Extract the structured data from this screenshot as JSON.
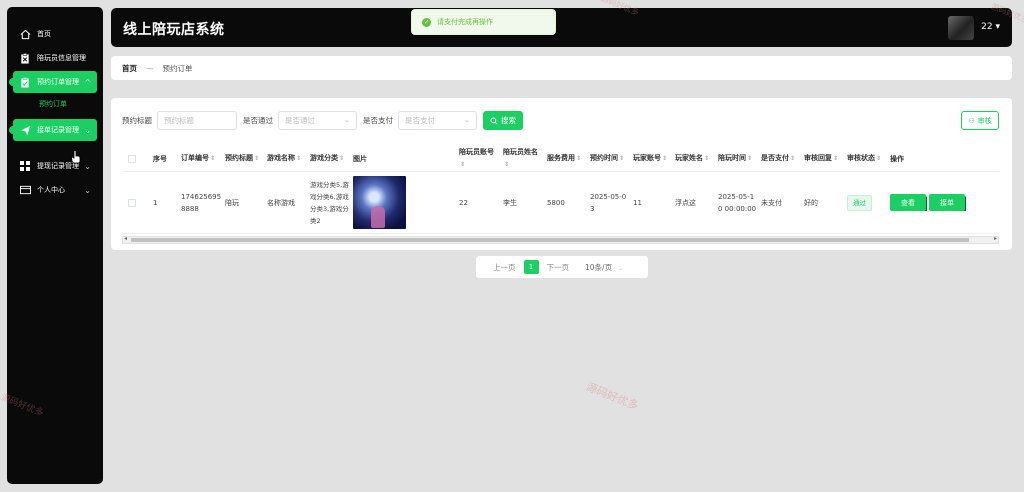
{
  "app": {
    "title": "线上陪玩店系统",
    "user": "22"
  },
  "toast": {
    "message": "请支付完成再操作"
  },
  "sidebar": {
    "items": [
      {
        "label": "首页",
        "icon": "home-icon"
      },
      {
        "label": "陪玩员信息管理",
        "icon": "clipboard-icon"
      },
      {
        "label": "预约订单管理",
        "icon": "clipboard-check-icon"
      },
      {
        "sub": "预约订单"
      },
      {
        "label": "接单记录管理",
        "icon": "send-icon"
      },
      {
        "label": "提现记录管理",
        "icon": "grid-icon"
      },
      {
        "label": "个人中心",
        "icon": "wallet-icon"
      }
    ]
  },
  "breadcrumb": {
    "home": "首页",
    "current": "预约订单"
  },
  "filters": {
    "title_label": "预约标题",
    "title_placeholder": "预约标题",
    "pass_label": "是否通过",
    "pass_placeholder": "是否通过",
    "paid_label": "是否支付",
    "paid_placeholder": "是否支付",
    "search_button": "搜索",
    "audit_button": "审核"
  },
  "table": {
    "headers": [
      "序号",
      "订单编号",
      "预约标题",
      "游戏名称",
      "游戏分类",
      "图片",
      "陪玩员账号",
      "陪玩员姓名",
      "服务费用",
      "预约时间",
      "玩家账号",
      "玩家姓名",
      "陪玩时间",
      "是否支付",
      "审核回复",
      "审核状态",
      "操作"
    ],
    "rows": [
      {
        "index": "1",
        "order_no": "1746256958888",
        "title": "陪玩",
        "game": "名称游戏",
        "category": "游戏分类5,游戏分类6,游戏分类3,游戏分类2",
        "companion_account": "22",
        "companion_name": "李生",
        "fee": "5800",
        "book_time": "2025-05-03",
        "player_account": "11",
        "player_name": "浮点这",
        "play_time": "2025-05-10 00:00:00",
        "paid": "未支付",
        "reply": "好的",
        "status": "通过",
        "actions": [
          "查看",
          "接单"
        ]
      }
    ]
  },
  "pager": {
    "prev": "上一页",
    "page": "1",
    "next": "下一页",
    "size": "10条/页"
  },
  "watermark": "源码好优多",
  "colors": {
    "accent": "#1ccf63",
    "sidebar": "#0a0a0a",
    "background": "#e1e1e1"
  }
}
